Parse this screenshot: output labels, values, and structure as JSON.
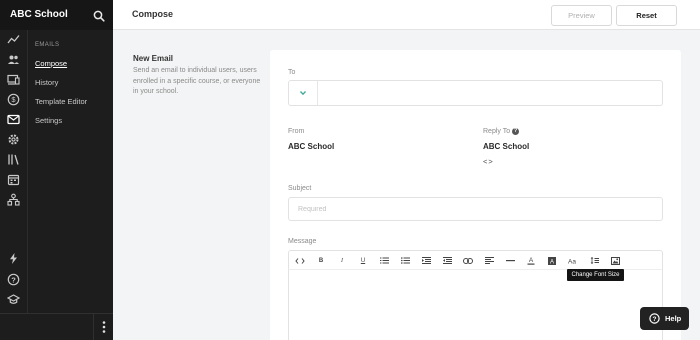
{
  "sidebar": {
    "school_name": "ABC School",
    "section_label": "EMAILS",
    "links": [
      {
        "label": "Compose",
        "active": true
      },
      {
        "label": "History",
        "active": false
      },
      {
        "label": "Template Editor",
        "active": false
      },
      {
        "label": "Settings",
        "active": false
      }
    ],
    "rail_icons": [
      "analytics-icon",
      "users-icon",
      "courses-icon",
      "sales-icon",
      "emails-icon",
      "settings-icon",
      "library-icon",
      "calendar-icon",
      "network-icon",
      "lightning-icon",
      "help-icon",
      "graduation-cap-icon"
    ]
  },
  "header": {
    "title": "Compose",
    "preview_label": "Preview",
    "reset_label": "Reset"
  },
  "intro": {
    "title": "New Email",
    "description": "Send an email to individual users, users enrolled in a specific course, or everyone in your school."
  },
  "form": {
    "to_label": "To",
    "to_value": "",
    "from_label": "From",
    "from_value": "ABC School",
    "reply_to_label": "Reply To",
    "reply_to_value": "ABC School",
    "reply_to_email": "<>",
    "subject_label": "Subject",
    "subject_placeholder": "Required",
    "message_label": "Message"
  },
  "editor": {
    "tooltip": "Change Font Size"
  },
  "help_button": {
    "label": "Help"
  },
  "colors": {
    "sidebar_bg": "#1d1d1d",
    "page_bg": "#f3f4f5",
    "accent_teal": "#3aa89a"
  }
}
